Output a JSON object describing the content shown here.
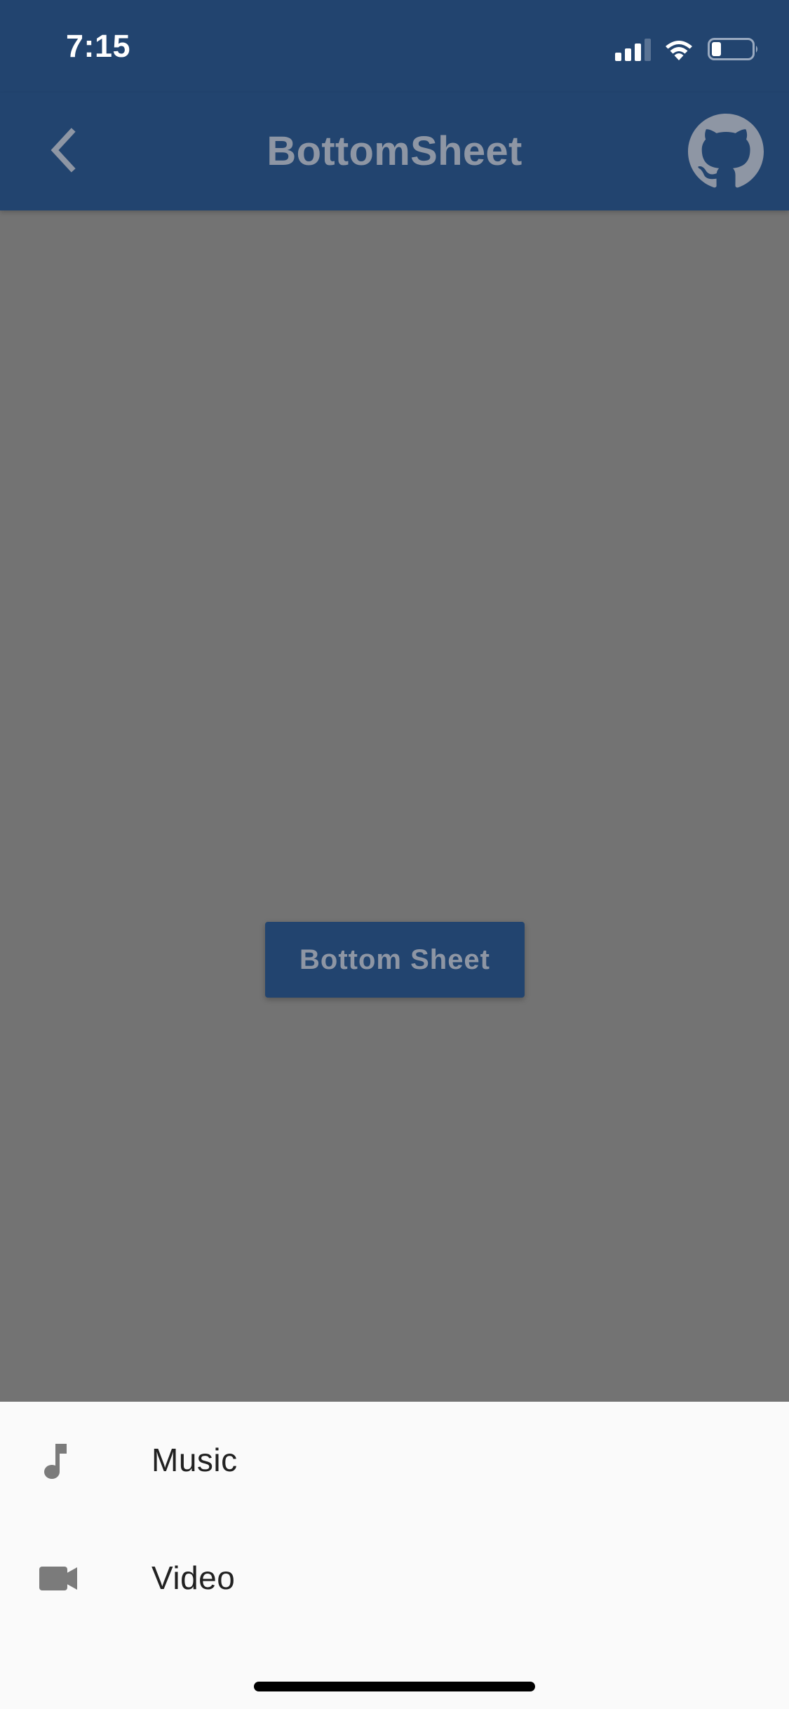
{
  "status_bar": {
    "time": "7:15",
    "signal_icon": "cellular-signal-icon",
    "wifi_icon": "wifi-icon",
    "battery_icon": "battery-icon"
  },
  "app_bar": {
    "title": "BottomSheet",
    "back_icon": "chevron-left-icon",
    "github_icon": "github-icon",
    "background_color": "#22446f"
  },
  "main": {
    "button_label": "Bottom Sheet",
    "overlay_color": "#737373"
  },
  "bottom_sheet": {
    "items": [
      {
        "label": "Music",
        "icon": "music-note-icon"
      },
      {
        "label": "Video",
        "icon": "videocam-icon"
      }
    ],
    "background_color": "#fafafa"
  }
}
